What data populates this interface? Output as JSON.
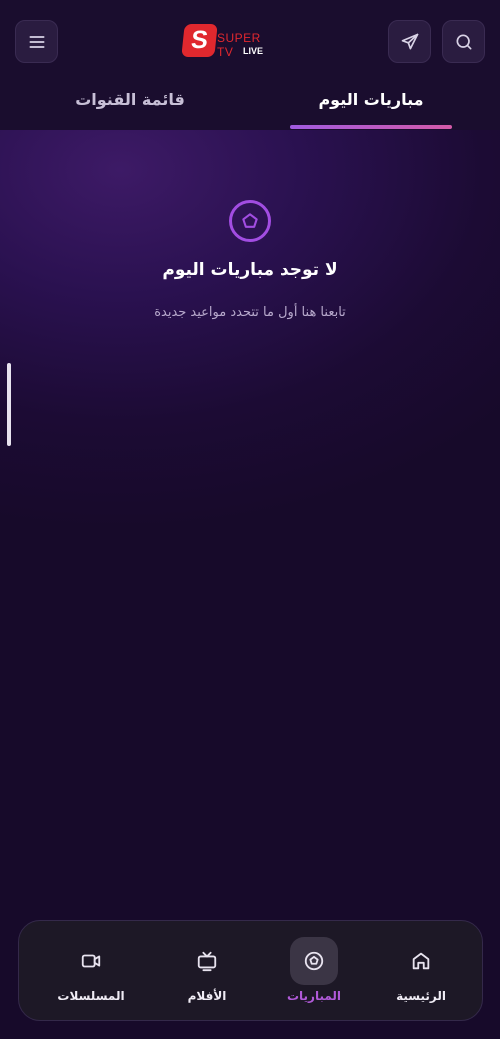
{
  "header": {
    "logo_main": "SUPER TV",
    "logo_sub": "LIVE",
    "logo_letter": "S"
  },
  "tabs": [
    {
      "label": "مباريات اليوم",
      "active": true
    },
    {
      "label": "قائمة القنوات",
      "active": false
    }
  ],
  "empty_state": {
    "title": "لا توجد مباريات اليوم",
    "subtitle": "تابعنا هنا أول ما تتحدد مواعيد جديدة"
  },
  "bottom_nav": [
    {
      "label": "الرئيسية",
      "icon": "home-icon",
      "active": false
    },
    {
      "label": "المباريات",
      "icon": "ball-icon",
      "active": true
    },
    {
      "label": "الأفلام",
      "icon": "tv-icon",
      "active": false
    },
    {
      "label": "المسلسلات",
      "icon": "video-icon",
      "active": false
    }
  ],
  "colors": {
    "accent": "#a24de2",
    "background": "#190b2c",
    "brand_red": "#e0282e"
  }
}
